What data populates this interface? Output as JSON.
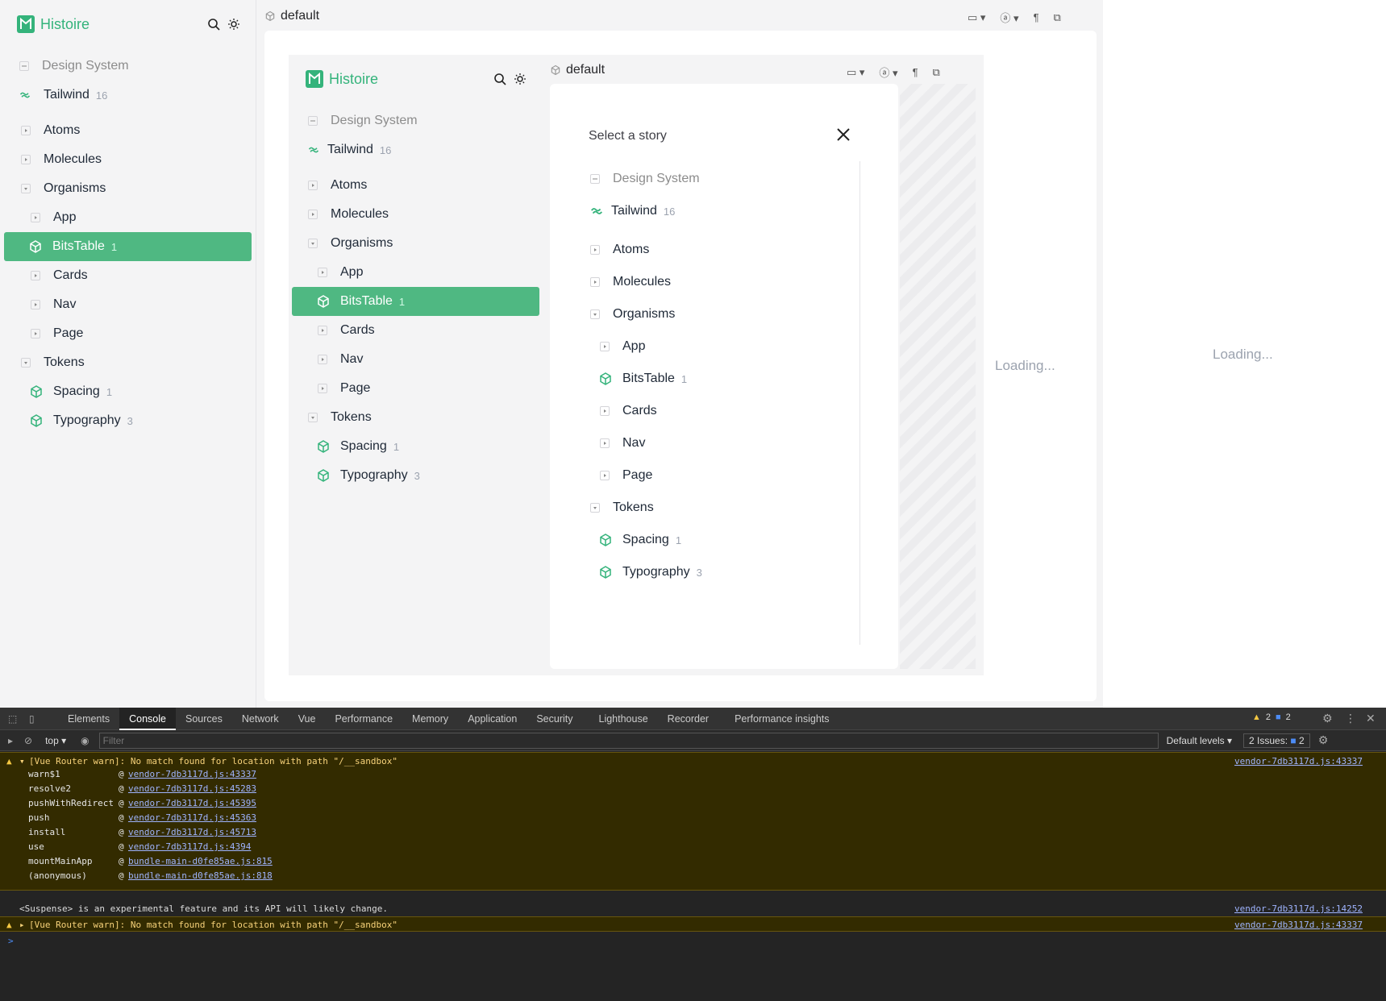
{
  "app": {
    "name": "Histoire",
    "story_title": "default",
    "loading": "Loading..."
  },
  "tree": {
    "design_system": "Design System",
    "tailwind": "Tailwind",
    "tailwind_count": "16",
    "atoms": "Atoms",
    "molecules": "Molecules",
    "organisms": "Organisms",
    "app": "App",
    "bitstable": "BitsTable",
    "bitstable_count": "1",
    "cards": "Cards",
    "nav": "Nav",
    "page": "Page",
    "tokens": "Tokens",
    "spacing": "Spacing",
    "spacing_count": "1",
    "typography": "Typography",
    "typography_count": "3"
  },
  "modal": {
    "title": "Select a story"
  },
  "colors": {
    "accent": "#4fb882",
    "sidebar_bg": "#f4f4f5"
  },
  "devtools": {
    "tabs": [
      "Elements",
      "Console",
      "Sources",
      "Network",
      "Vue",
      "Performance",
      "Memory",
      "Application",
      "Security",
      "Lighthouse",
      "Recorder",
      "Performance insights"
    ],
    "context": "top",
    "filter_placeholder": "Filter",
    "levels": "Default levels",
    "issues": "2 Issues:",
    "issues_count": "2",
    "warn_count": "2",
    "info_count": "2",
    "warn_msg": "[Vue Router warn]: No match found for location with path \"/__sandbox\"",
    "warn_src": "vendor-7db3117d.js:43337",
    "stack": [
      {
        "fn": "warn$1",
        "src": "vendor-7db3117d.js:43337"
      },
      {
        "fn": "resolve2",
        "src": "vendor-7db3117d.js:45283"
      },
      {
        "fn": "pushWithRedirect",
        "src": "vendor-7db3117d.js:45395"
      },
      {
        "fn": "push",
        "src": "vendor-7db3117d.js:45363"
      },
      {
        "fn": "install",
        "src": "vendor-7db3117d.js:45713"
      },
      {
        "fn": "use",
        "src": "vendor-7db3117d.js:4394"
      },
      {
        "fn": "mountMainApp",
        "src": "bundle-main-d0fe85ae.js:815"
      },
      {
        "fn": "(anonymous)",
        "src": "bundle-main-d0fe85ae.js:818"
      }
    ],
    "suspense_msg": "<Suspense> is an experimental feature and its API will likely change.",
    "suspense_src": "vendor-7db3117d.js:14252",
    "warn2_msg": "[Vue Router warn]: No match found for location with path \"/__sandbox\"",
    "warn2_src": "vendor-7db3117d.js:43337",
    "prompt": ">"
  }
}
